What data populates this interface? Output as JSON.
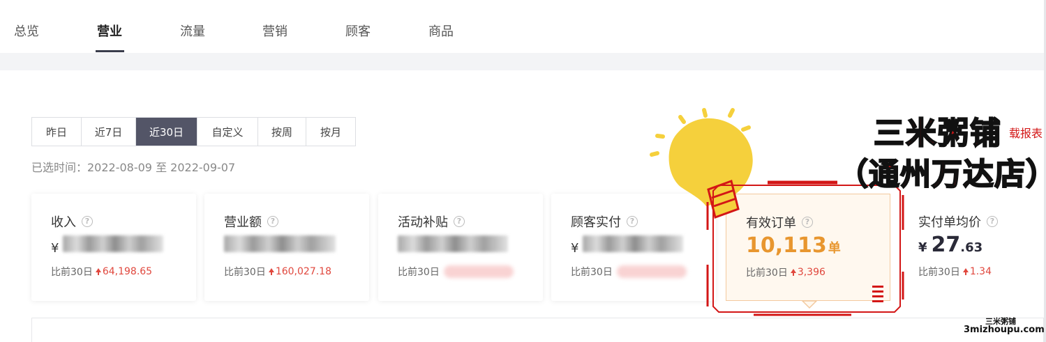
{
  "tabs": [
    {
      "label": "总览",
      "active": false
    },
    {
      "label": "营业",
      "active": true
    },
    {
      "label": "流量",
      "active": false
    },
    {
      "label": "营销",
      "active": false
    },
    {
      "label": "顾客",
      "active": false
    },
    {
      "label": "商品",
      "active": false
    }
  ],
  "date_range": {
    "options": [
      "昨日",
      "近7日",
      "近30日",
      "自定义",
      "按周",
      "按月"
    ],
    "active": "近30日",
    "selected_time": "已选时间：2022-08-09 至 2022-09-07"
  },
  "cards": [
    {
      "title": "收入",
      "currency": "¥",
      "compare_label": "比前30日",
      "delta": "64,198.65"
    },
    {
      "title": "营业额",
      "currency": "",
      "compare_label": "比前30日",
      "delta": "160,027.18"
    },
    {
      "title": "活动补贴",
      "currency": "",
      "compare_label": "比前30日",
      "delta": ""
    },
    {
      "title": "顾客实付",
      "currency": "¥",
      "compare_label": "比前30日",
      "delta": ""
    },
    {
      "title": "有效订单",
      "value": "10,113",
      "unit": "单",
      "compare_label": "比前30日",
      "delta": "3,396"
    },
    {
      "title": "实付单均价",
      "currency": "¥",
      "value_int": "27",
      "value_dec": ".63",
      "compare_label": "比前30日",
      "delta": "1.34"
    }
  ],
  "overlay": {
    "headline": "三米粥铺",
    "side_text": "载报表",
    "subtitle": "（通州万达店）",
    "watermark_line1": "三米粥铺",
    "watermark_line2": "3mizhoupu.com"
  },
  "colors": {
    "accent_dark": "#535567",
    "delta_red": "#e0473d",
    "highlight_orange": "#e8962f",
    "promo_red": "#d31616",
    "bulb_yellow": "#f5d03c"
  },
  "icons": [
    "help-icon",
    "arrow-up-icon",
    "lightbulb-icon"
  ]
}
